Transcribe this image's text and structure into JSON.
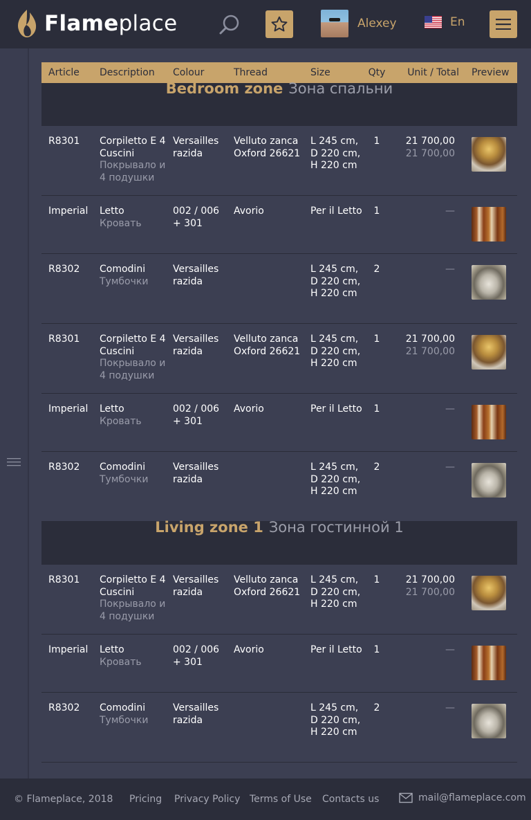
{
  "header": {
    "logo_bold": "Flame",
    "logo_light": "place",
    "user_name": "Alexey",
    "language": "En"
  },
  "table": {
    "columns": [
      "Article",
      "Description",
      "Colour",
      "Thread",
      "Size",
      "Qty",
      "Unit / Total",
      "Preview"
    ],
    "zones": [
      {
        "title_en": "Bedroom zone",
        "title_ru": "Зона спальни",
        "rows": [
          {
            "article": "R8301",
            "desc": "Corpiletto E 4 Cuscini",
            "desc_ru": "Покрывало и 4 подушки",
            "colour": "Versailles razida",
            "thread": "Velluto zanca Oxford 26621",
            "size": "L 245 cm, D 220 cm, H 220 cm",
            "qty": "1",
            "unit": "21 700,00",
            "total": "21 700,00",
            "preview": "bed-thumbnail"
          },
          {
            "article": "Imperial",
            "desc": "Letto",
            "desc_ru": "Кровать",
            "colour": "002 / 006 + 301",
            "thread": "Avorio",
            "size": "Per il Letto",
            "qty": "1",
            "unit": "—",
            "total": "",
            "preview": "wardrobe-thumbnail"
          },
          {
            "article": "R8302",
            "desc": "Comodini",
            "desc_ru": "Тумбочки",
            "colour": "Versailles razida",
            "thread": "",
            "size": "L 245 cm, D 220 cm, H 220 cm",
            "qty": "2",
            "unit": "—",
            "total": "",
            "preview": "sofa-thumbnail"
          },
          {
            "article": "R8301",
            "desc": "Corpiletto E 4 Cuscini",
            "desc_ru": "Покрывало и 4 подушки",
            "colour": "Versailles razida",
            "thread": "Velluto zanca Oxford 26621",
            "size": "L 245 cm, D 220 cm, H 220 cm",
            "qty": "1",
            "unit": "21 700,00",
            "total": "21 700,00",
            "preview": "bed-thumbnail"
          },
          {
            "article": "Imperial",
            "desc": "Letto",
            "desc_ru": "Кровать",
            "colour": "002 / 006 + 301",
            "thread": "Avorio",
            "size": "Per il Letto",
            "qty": "1",
            "unit": "—",
            "total": "",
            "preview": "wardrobe-thumbnail"
          },
          {
            "article": "R8302",
            "desc": "Comodini",
            "desc_ru": "Тумбочки",
            "colour": "Versailles razida",
            "thread": "",
            "size": "L 245 cm, D 220 cm, H 220 cm",
            "qty": "2",
            "unit": "—",
            "total": "",
            "preview": "sofa-thumbnail"
          }
        ]
      },
      {
        "title_en": "Living zone 1",
        "title_ru": "Зона гостинной 1",
        "rows": [
          {
            "article": "R8301",
            "desc": "Corpiletto E 4 Cuscini",
            "desc_ru": "Покрывало и 4 подушки",
            "colour": "Versailles razida",
            "thread": "Velluto zanca Oxford 26621",
            "size": "L 245 cm, D 220 cm, H 220 cm",
            "qty": "1",
            "unit": "21 700,00",
            "total": "21 700,00",
            "preview": "bed-thumbnail"
          },
          {
            "article": "Imperial",
            "desc": "Letto",
            "desc_ru": "Кровать",
            "colour": "002 / 006 + 301",
            "thread": "Avorio",
            "size": "Per il Letto",
            "qty": "1",
            "unit": "—",
            "total": "",
            "preview": "wardrobe-thumbnail"
          },
          {
            "article": "R8302",
            "desc": "Comodini",
            "desc_ru": "Тумбочки",
            "colour": "Versailles razida",
            "thread": "",
            "size": "L 245 cm, D 220 cm, H 220 cm",
            "qty": "2",
            "unit": "—",
            "total": "",
            "preview": "sofa-thumbnail"
          }
        ]
      }
    ]
  },
  "footer": {
    "copyright": "© Flameplace, 2018",
    "links": [
      "Pricing",
      "Privacy Policy",
      "Terms of Use",
      "Contacts us"
    ],
    "email": "mail@flameplace.com"
  },
  "colors": {
    "accent": "#c8a46b",
    "header_bg": "#2b2d3a",
    "page_bg": "#3c3f52"
  },
  "icons": {
    "logo": "flame-icon",
    "search": "search-icon",
    "favorites": "star-icon",
    "menu": "hamburger-icon",
    "sidebar": "sidebar-menu-icon",
    "mail": "mail-icon"
  }
}
